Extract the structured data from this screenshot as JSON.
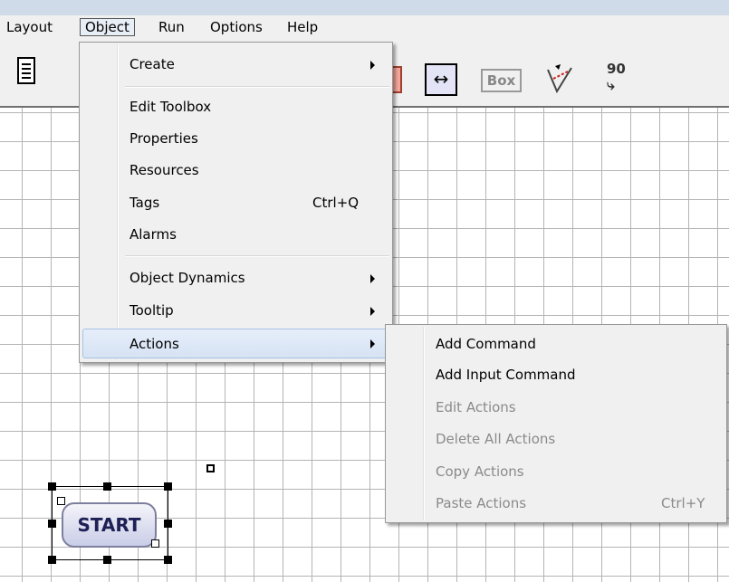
{
  "menubar": {
    "items": [
      "Layout",
      "Object",
      "Run",
      "Options",
      "Help"
    ],
    "active": "Object"
  },
  "toolbar": {
    "box_label": "Box",
    "rotate_label": "90",
    "icons": [
      "document-icon",
      "color-icon",
      "horizontal-arrow-icon",
      "box-icon",
      "trend-icon",
      "rotate-icon"
    ]
  },
  "object_menu": {
    "items": [
      {
        "label": "Create",
        "submenu": true
      },
      {
        "label": "Edit Toolbox"
      },
      {
        "label": "Properties"
      },
      {
        "label": "Resources"
      },
      {
        "label": "Tags",
        "shortcut": "Ctrl+Q"
      },
      {
        "label": "Alarms"
      },
      {
        "label": "Object Dynamics",
        "submenu": true
      },
      {
        "label": "Tooltip",
        "submenu": true
      },
      {
        "label": "Actions",
        "submenu": true,
        "highlighted": true
      }
    ]
  },
  "actions_menu": {
    "items": [
      {
        "label": "Add Command",
        "enabled": true
      },
      {
        "label": "Add Input Command",
        "enabled": true
      },
      {
        "label": "Edit Actions",
        "enabled": false
      },
      {
        "label": "Delete All Actions",
        "enabled": false
      },
      {
        "label": "Copy Actions",
        "enabled": false
      },
      {
        "label": "Paste Actions",
        "enabled": false,
        "shortcut": "Ctrl+Y"
      }
    ]
  },
  "canvas": {
    "start_button_label": "START"
  },
  "colors": {
    "menu_highlight": "#d6e3f4",
    "grid_line": "#b4b4b4",
    "disabled_text": "#8a8a8a"
  }
}
